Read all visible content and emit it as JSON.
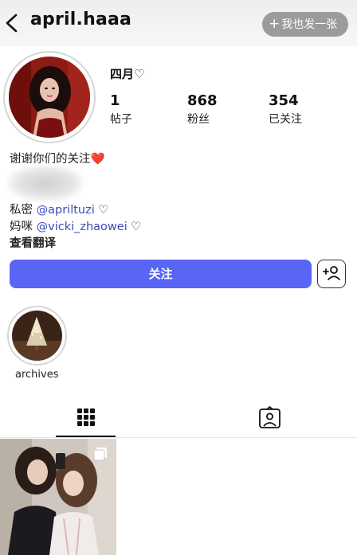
{
  "header": {
    "username": "april.haaa",
    "action_label": "我也发一张"
  },
  "profile": {
    "nickname": "四月♡",
    "stats": [
      {
        "value": "1",
        "label": "帖子"
      },
      {
        "value": "868",
        "label": "粉丝"
      },
      {
        "value": "354",
        "label": "已关注"
      }
    ]
  },
  "bio": {
    "line1": "谢谢你们的关注❤️",
    "line2_prefix": "私密 ",
    "line2_mention": "@apriltuzi",
    "line2_suffix": " ♡",
    "line3_prefix": "妈咪 ",
    "line3_mention": "@vicki_zhaowei",
    "line3_suffix": " ♡",
    "translate": "查看翻译"
  },
  "actions": {
    "follow_label": "关注"
  },
  "highlights": [
    {
      "label": "archives"
    }
  ],
  "tabs": [
    {
      "icon": "grid-icon",
      "active": true
    },
    {
      "icon": "tagged-icon",
      "active": false
    }
  ],
  "colors": {
    "accent": "#5865f5",
    "mention": "#3b4bb8"
  }
}
